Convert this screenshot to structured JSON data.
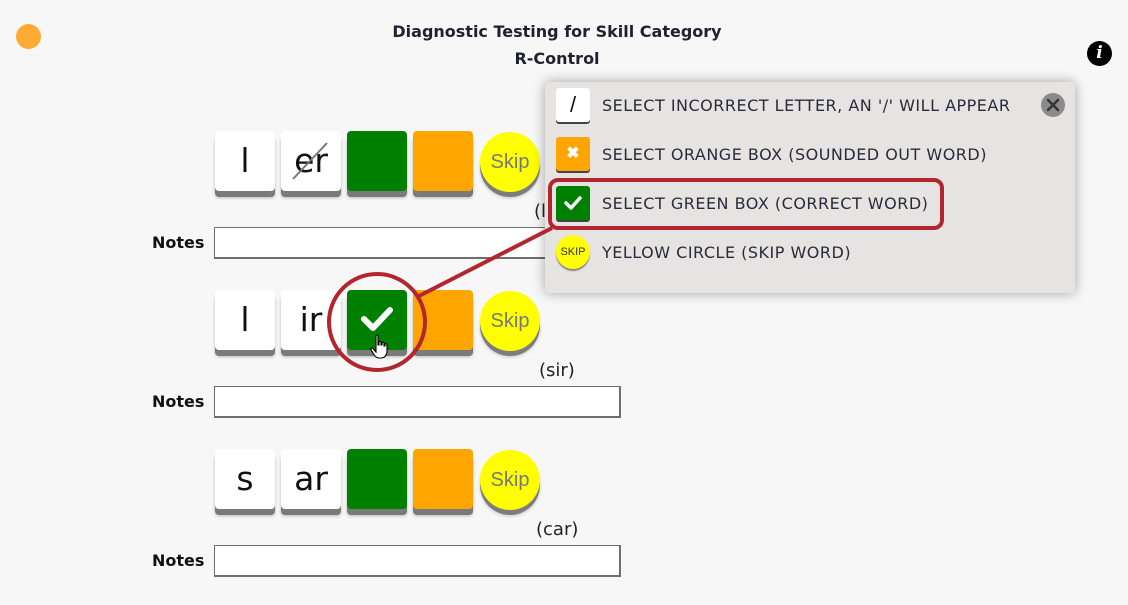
{
  "header": {
    "title": "Diagnostic Testing for Skill Category",
    "subtitle": "R-Control",
    "status_dot_color": "#ffab33",
    "info_icon": "info-circle-icon",
    "info_glyph": "i"
  },
  "rows": [
    {
      "letters": [
        "l",
        "er"
      ],
      "struck_letter_index": 1,
      "correct_selected": false,
      "skip_label": "Skip",
      "hint": "(l",
      "notes_label": "Notes",
      "notes_value": ""
    },
    {
      "letters": [
        "l",
        "ir"
      ],
      "struck_letter_index": null,
      "correct_selected": true,
      "skip_label": "Skip",
      "hint": "(sir)",
      "notes_label": "Notes",
      "notes_value": ""
    },
    {
      "letters": [
        "s",
        "ar"
      ],
      "struck_letter_index": null,
      "correct_selected": false,
      "skip_label": "Skip",
      "hint": "(car)",
      "notes_label": "Notes",
      "notes_value": ""
    }
  ],
  "legend": {
    "items": [
      {
        "swatch": "white",
        "swatch_text": "/",
        "label": "SELECT INCORRECT LETTER, AN '/' WILL APPEAR"
      },
      {
        "swatch": "orange",
        "swatch_text": "✖",
        "label": "SELECT ORANGE BOX (SOUNDED OUT WORD)"
      },
      {
        "swatch": "green",
        "swatch_text": "",
        "label": "SELECT GREEN BOX (CORRECT WORD)"
      },
      {
        "swatch": "yellow",
        "swatch_text": "SKIP",
        "label": "YELLOW CIRCLE (SKIP WORD)"
      }
    ],
    "close_icon": "close-circle-icon",
    "highlighted_item_index": 2
  },
  "colors": {
    "correct": "#008000",
    "sounded_out": "#ffa500",
    "skip": "#ffff00",
    "annotation": "#b3262d"
  }
}
